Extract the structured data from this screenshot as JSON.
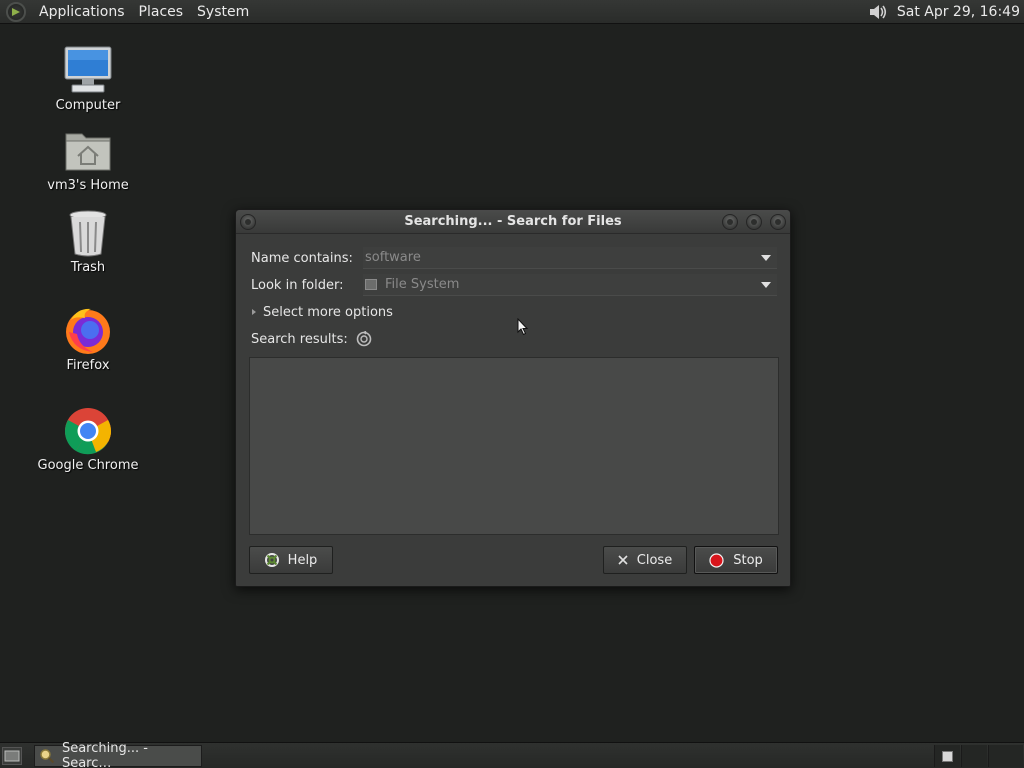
{
  "top_panel": {
    "menus": [
      "Applications",
      "Places",
      "System"
    ],
    "clock": "Sat Apr 29, 16:49",
    "icons": {
      "logo": "distro-logo-icon",
      "volume": "volume-icon"
    }
  },
  "desktop": {
    "icons": [
      {
        "label": "Computer",
        "icon": "computer-icon"
      },
      {
        "label": "vm3's Home",
        "icon": "home-folder-icon"
      },
      {
        "label": "Trash",
        "icon": "trash-icon"
      },
      {
        "label": "Firefox",
        "icon": "firefox-icon"
      },
      {
        "label": "Google Chrome",
        "icon": "chrome-icon"
      }
    ]
  },
  "dialog": {
    "title": "Searching... - Search for Files",
    "name_label": "Name contains:",
    "name_value": "software",
    "folder_label": "Look in folder:",
    "folder_value": "File System",
    "more_options": "Select more options",
    "results_label": "Search results:",
    "buttons": {
      "help": "Help",
      "close": "Close",
      "stop": "Stop"
    }
  },
  "taskbar": {
    "task_label": "Searching... - Searc…"
  },
  "colors": {
    "desktop_bg": "#1f211f",
    "stop_red": "#d8151c",
    "help_green": "#5d8a33"
  }
}
